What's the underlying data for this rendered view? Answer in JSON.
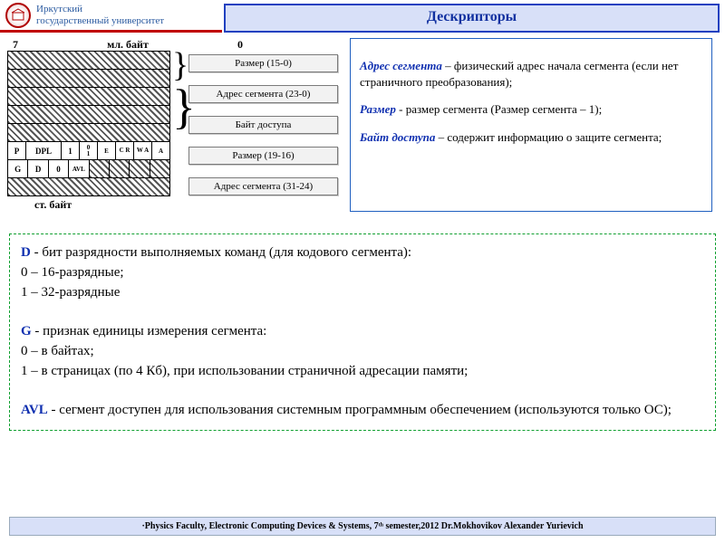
{
  "header": {
    "university_line1": "Иркутский",
    "university_line2": "государственный университет",
    "title": "Дескрипторы"
  },
  "diagram": {
    "bit_high": "7",
    "bit_low": "0",
    "ml_byte": "мл. байт",
    "st_byte": "ст. байт",
    "row5": {
      "P": "P",
      "DPL": "DPL",
      "one": "1",
      "zero1": "0",
      "E": "E",
      "C_R": "C R",
      "W_A": "W A",
      "A": "A"
    },
    "row6_sub": {
      "zero": "0",
      "one": "1"
    },
    "row6": {
      "G": "G",
      "D": "D",
      "zero": "0",
      "AVL": "AVL"
    },
    "labels": {
      "l1": "Размер (15-0)",
      "l2": "Адрес сегмента (23-0)",
      "l3": "Байт доступа",
      "l4": "Размер (19-16)",
      "l5": "Адрес сегмента (31-24)"
    }
  },
  "defs": {
    "addr_term": "Адрес сегмента",
    "addr_text": " – физический адрес начала сегмента (если нет страничного преобразования);",
    "size_term": "Размер",
    "size_text": "  -  размер сегмента (Размер сегмента  – 1);",
    "access_term": "Байт доступа",
    "access_text": " – содержит информацию о защите сегмента;"
  },
  "big": {
    "D": "D",
    "D_text": "  - бит разрядности выполняемых команд (для кодового сегмента):",
    "D0": "0 – 16-разрядные;",
    "D1": "1 – 32-разрядные",
    "G": "G",
    "G_text": "   - признак единицы измерения сегмента:",
    "G0": "0 – в байтах;",
    "G1": "1 – в страницах (по 4 Кб), при использовании страничной адресации памяти;",
    "AVL": "AVL",
    "AVL_text": "   -   сегмент доступен для использования системным программным обеспечением (используются только ОС);"
  },
  "footer": "·Physics Faculty, Electronic Computing Devices & Systems, 7ᵗʰ semester,2012 Dr.Mokhovikov Alexander Yurievich"
}
